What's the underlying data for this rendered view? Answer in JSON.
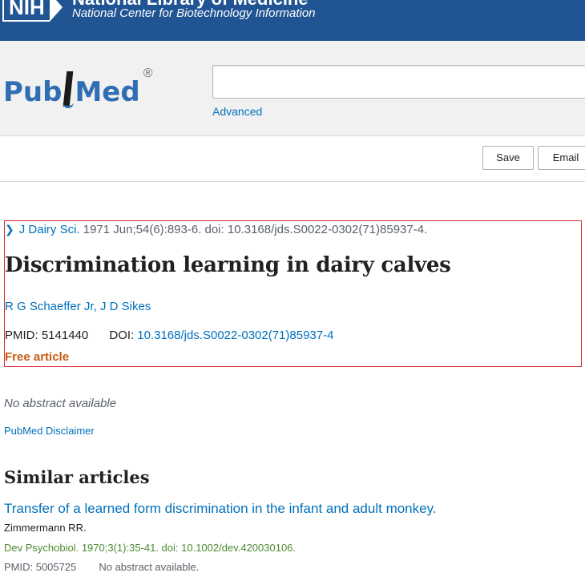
{
  "banner": {
    "nih_logo_text": "NIH",
    "org_title": "National Library of Medicine",
    "org_subtitle": "National Center for Biotechnology Information"
  },
  "search": {
    "logo_text_left": "Pub",
    "logo_text_right": "Med",
    "logo_mark": "®",
    "query_value": "",
    "advanced_label": "Advanced"
  },
  "actions": {
    "save_label": "Save",
    "email_label": "Email"
  },
  "article": {
    "journal": "J Dairy Sci.",
    "citation_rest": "1971 Jun;54(6):893-6. doi: 10.3168/jds.S0022-0302(71)85937-4.",
    "title": "Discrimination learning in dairy calves",
    "authors": "R G Schaeffer Jr, J D Sikes",
    "pmid_label": "PMID: 5141440",
    "doi_label": "DOI:",
    "doi_value": "10.3168/jds.S0022-0302(71)85937-4",
    "free_label": "Free article",
    "highlight_color": "#d9262c"
  },
  "body": {
    "no_abstract": "No abstract available",
    "disclaimer_link": "PubMed Disclaimer"
  },
  "similar": {
    "heading": "Similar articles",
    "items": [
      {
        "title": "Transfer of a learned form discrimination in the infant and adult monkey.",
        "authors": "Zimmermann RR.",
        "citation": "Dev Psychobiol. 1970;3(1):35-41. doi: 10.1002/dev.420030106.",
        "pmid": "PMID: 5005725",
        "note": "No abstract available."
      }
    ]
  },
  "colors": {
    "banner_bg": "#205493",
    "link": "#0071bc",
    "free_article": "#c75a12",
    "citation_green": "#4e8a33"
  }
}
